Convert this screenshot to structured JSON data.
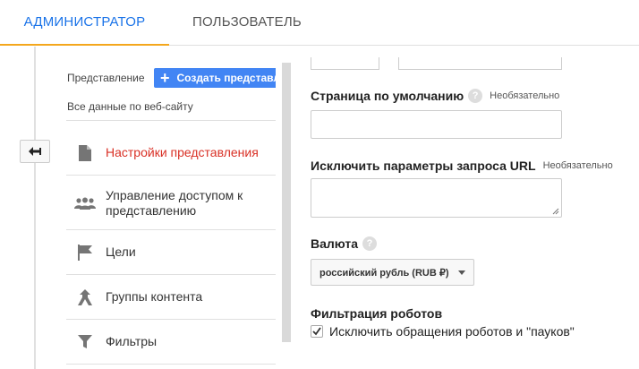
{
  "tabs": {
    "admin": "АДМИНИСТРАТОР",
    "user": "ПОЛЬЗОВАТЕЛЬ"
  },
  "sidebar": {
    "view_label": "Представление",
    "create_button": "Создать представление",
    "view_selected": "Все данные по веб-сайту",
    "items": [
      {
        "label": "Настройки представления",
        "icon": "document-icon",
        "active": true
      },
      {
        "label": "Управление доступом к представлению",
        "icon": "people-icon",
        "active": false
      },
      {
        "label": "Цели",
        "icon": "flag-icon",
        "active": false
      },
      {
        "label": "Группы контента",
        "icon": "content-groups-icon",
        "active": false
      },
      {
        "label": "Фильтры",
        "icon": "filter-icon",
        "active": false
      }
    ]
  },
  "form": {
    "default_page": {
      "label": "Страница по умолчанию",
      "optional": "Необязательно",
      "value": ""
    },
    "exclude_params": {
      "label": "Исключить параметры запроса URL",
      "optional": "Необязательно",
      "value": ""
    },
    "currency": {
      "label": "Валюта",
      "value": "российский рубль (RUB ₽)"
    },
    "bot_filtering": {
      "label": "Фильтрация роботов",
      "checkbox_label": "Исключить обращения роботов и \"пауков\"",
      "checked": true
    }
  },
  "colors": {
    "accent_blue": "#1a73e8",
    "active_red": "#d93025",
    "tab_underline": "#f4a71d",
    "button_blue": "#4285f4"
  }
}
